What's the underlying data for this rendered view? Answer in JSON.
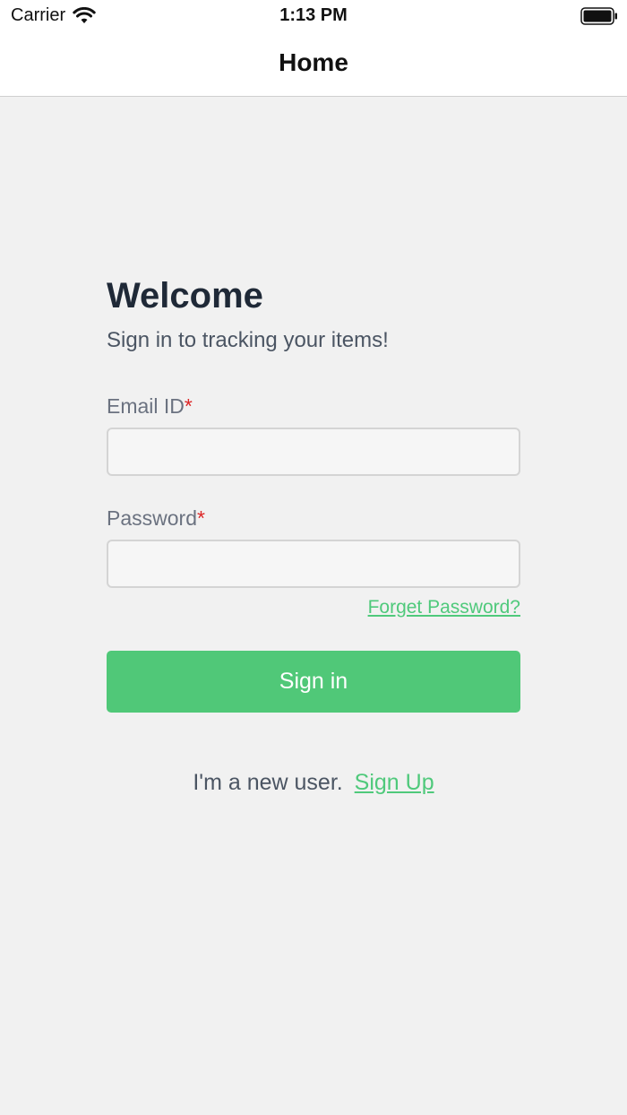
{
  "status_bar": {
    "carrier": "Carrier",
    "time": "1:13 PM",
    "icons": [
      "wifi-icon",
      "battery-icon"
    ]
  },
  "nav": {
    "title": "Home"
  },
  "login": {
    "heading": "Welcome",
    "subtitle": "Sign in to tracking your items!",
    "email_label": "Email ID",
    "email_value": "",
    "password_label": "Password",
    "password_value": "",
    "required_mark": "*",
    "forgot_label": "Forget Password?",
    "signin_label": "Sign in",
    "new_user_text": "I'm a new user.",
    "signup_label": "Sign Up"
  },
  "colors": {
    "accent": "#50c878",
    "required": "#dc2626",
    "background": "#f1f1f1"
  }
}
